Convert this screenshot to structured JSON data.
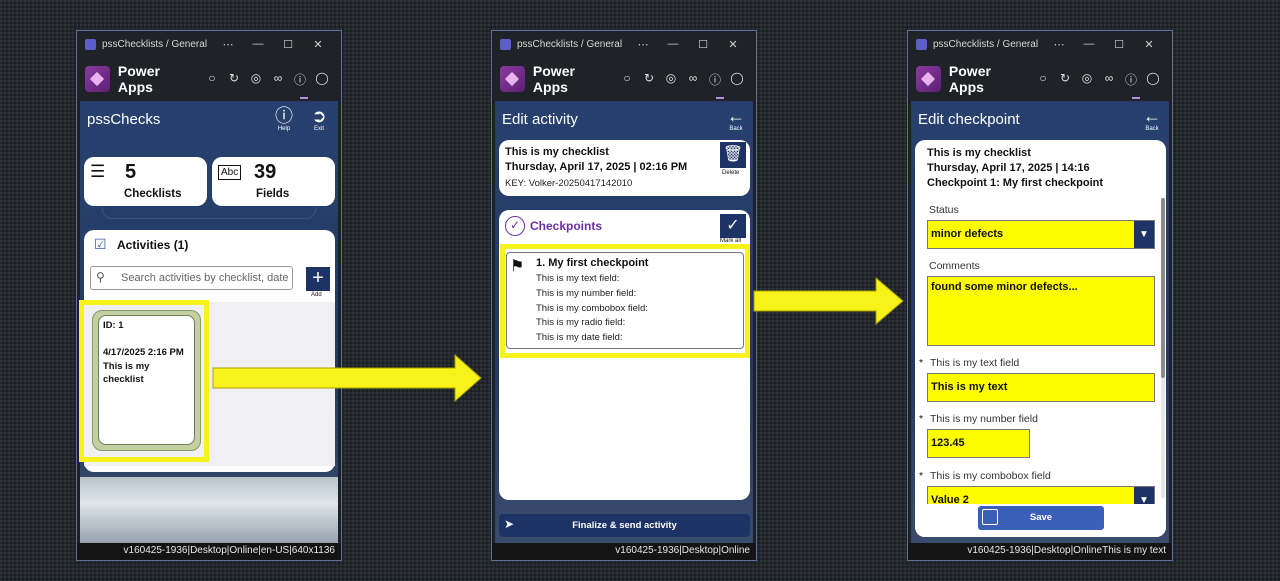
{
  "window_title": "pssChecklists / General",
  "app_name": "Power Apps",
  "titlebar_controls": [
    "⋯",
    "—",
    "☐",
    "✕"
  ],
  "toolbar_icons": [
    "chat-icon",
    "refresh-icon",
    "globe-icon",
    "link-icon",
    "info-icon",
    "shield-icon"
  ],
  "screen1": {
    "title": "pssChecks",
    "help_label": "Help",
    "exit_label": "Exit",
    "stats": [
      {
        "value": "5",
        "label": "Checklists",
        "icon": "list-icon"
      },
      {
        "value": "39",
        "label": "Fields",
        "icon": "abc-icon",
        "icon_text": "Abc"
      }
    ],
    "activities_title": "Activities (1)",
    "search_placeholder": "Search activities by checklist, date",
    "add_label": "Add",
    "activity_card": {
      "id": "ID: 1",
      "datetime": "4/17/2025 2:16 PM",
      "name": "This is my checklist"
    },
    "status": "v160425-1936|Desktop|Online|en-US|640x1136"
  },
  "screen2": {
    "title": "Edit activity",
    "back_label": "Back",
    "checklist_name": "This is my checklist",
    "checklist_datetime": "Thursday, April 17, 2025 | 02:16 PM",
    "checklist_key": "KEY: Volker-20250417142010",
    "delete_label": "Delete",
    "checkpoints_title": "Checkpoints",
    "mark_all_label": "Mark all",
    "checkpoint": {
      "title": "1. My first checkpoint",
      "fields": [
        "This is my text field:",
        "This is my number field:",
        "This is my combobox field:",
        "This is my radio field:",
        "This is my date field:"
      ]
    },
    "finalize_label": "Finalize & send activity",
    "status": "v160425-1936|Desktop|Online"
  },
  "screen3": {
    "title": "Edit checkpoint",
    "back_label": "Back",
    "checklist_name": "This is my checklist",
    "checklist_datetime": "Thursday, April 17, 2025 | 14:16",
    "checkpoint_name": "Checkpoint 1: My first checkpoint",
    "status_label": "Status",
    "status_value": "minor defects",
    "comments_label": "Comments",
    "comments_value": "found some minor defects...",
    "required_mark": "*",
    "text_field_label": "This is my text field",
    "text_field_value": "This is my text",
    "number_field_label": "This is my number field",
    "number_field_value": "123.45",
    "combobox_field_label": "This is my combobox field",
    "combobox_field_value": "Value 2",
    "save_label": "Save",
    "status": "v160425-1936|Desktop|OnlineThis is my text"
  },
  "colors": {
    "highlight": "#f7f31a",
    "app_bg": "#253a66",
    "accent_purple": "#6b2fa0",
    "navy": "#1d3366"
  }
}
